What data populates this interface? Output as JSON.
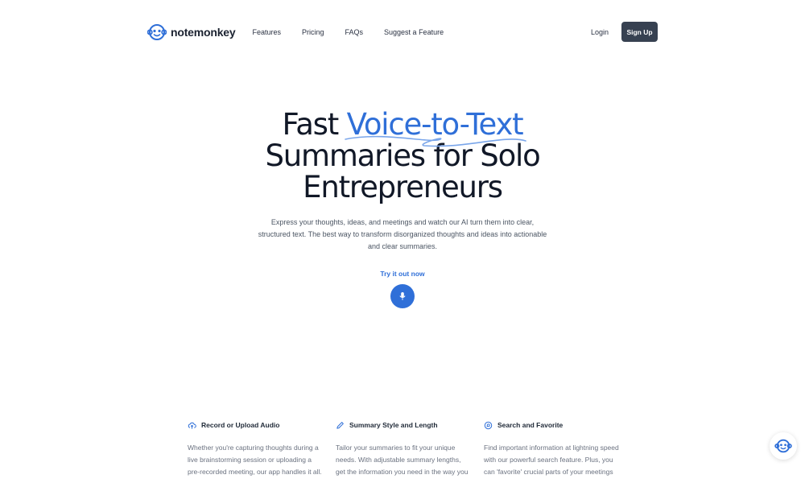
{
  "brand": {
    "name": "notemonkey",
    "logo_icon": "monkey-logo-icon",
    "color": "#2f6fd8"
  },
  "nav": {
    "links": [
      "Features",
      "Pricing",
      "FAQs",
      "Suggest a Feature"
    ],
    "login": "Login",
    "signup": "Sign Up"
  },
  "hero": {
    "headline_pre": "Fast ",
    "headline_accent": "Voice-to-Text",
    "headline_line2": "Summaries for Solo",
    "headline_line3": "Entrepreneurs",
    "subtitle": "Express your thoughts, ideas, and meetings and watch our AI turn them into clear, structured text. The best way to transform disorganized thoughts and ideas into actionable and clear summaries.",
    "cta_label": "Try it out now",
    "cta_icon": "microphone-icon"
  },
  "features": [
    {
      "icon": "cloud-upload-icon",
      "title": "Record or Upload Audio",
      "body": "Whether you're capturing thoughts during a live brainstorming session or uploading a pre-recorded meeting, our app handles it all."
    },
    {
      "icon": "pencil-icon",
      "title": "Summary Style and Length",
      "body": "Tailor your summaries to fit your unique needs. With adjustable summary lengths, get the information you need in the way you"
    },
    {
      "icon": "search-icon",
      "title": "Search and Favorite",
      "body": "Find important information at lightning speed with our powerful search feature. Plus, you can 'favorite' crucial parts of your meetings"
    }
  ],
  "floating": {
    "icon": "monkey-helper-icon"
  },
  "colors": {
    "accent": "#2f6fd8",
    "signup_bg": "#374151",
    "heading": "#111827"
  }
}
